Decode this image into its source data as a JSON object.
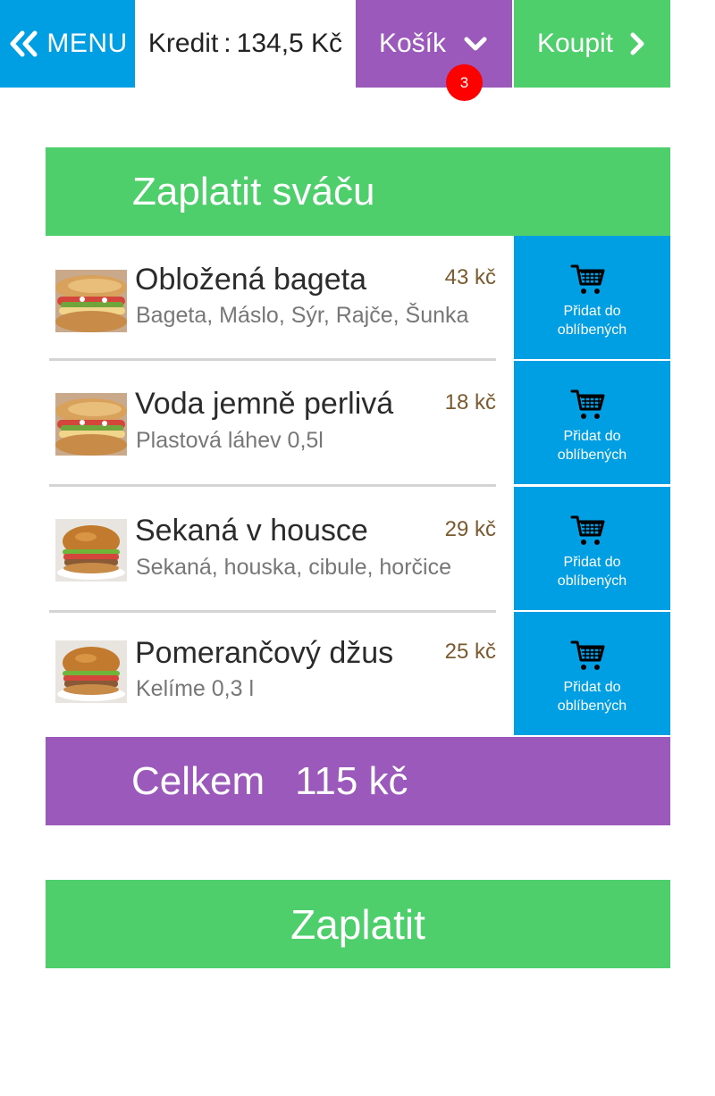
{
  "header": {
    "menu_label": "MENU",
    "credit_label": "Kredit",
    "credit_separator": ":",
    "credit_value": "134,5 Kč",
    "cart_label": "Košík",
    "cart_count": "3",
    "buy_label": "Koupit"
  },
  "section": {
    "title": "Zaplatit sváču"
  },
  "items": [
    {
      "name": "Obložená bageta",
      "desc": "Bageta, Máslo, Sýr, Rajče, Šunka",
      "price": "43 kč",
      "fav_line1": "Přidat do",
      "fav_line2": "oblíbených",
      "thumb": "bageta"
    },
    {
      "name": "Voda jemně perlivá",
      "desc": "Plastová láhev 0,5l",
      "price": "18 kč",
      "fav_line1": "Přidat do",
      "fav_line2": "oblíbených",
      "thumb": "bageta"
    },
    {
      "name": "Sekaná v housce",
      "desc": "Sekaná, houska, cibule, horčice",
      "price": "29 kč",
      "fav_line1": "Přidat do",
      "fav_line2": "oblíbených",
      "thumb": "burger"
    },
    {
      "name": "Pomerančový džus",
      "desc": "Kelíme 0,3 l",
      "price": "25 kč",
      "fav_line1": "Přidat do",
      "fav_line2": "oblíbených",
      "thumb": "burger"
    }
  ],
  "total": {
    "label": "Celkem",
    "value": "115 kč"
  },
  "pay_label": "Zaplatit",
  "colors": {
    "blue": "#009ee3",
    "purple": "#9b59bb",
    "green": "#4fce6c",
    "badge": "#ff0000",
    "price": "#7a5a2e"
  }
}
